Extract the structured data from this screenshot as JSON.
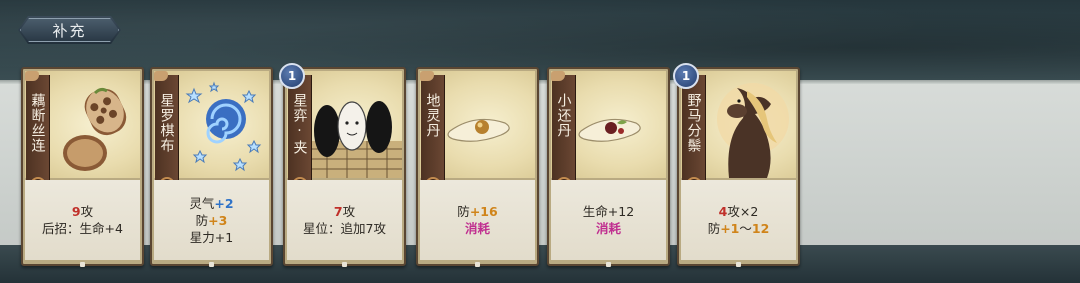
{
  "section": {
    "title": "补充"
  },
  "cards": [
    {
      "name": "藕断丝连",
      "icon": "lotus-root-icon",
      "badge": null,
      "desc": [
        "",
        "后招：生命+4"
      ],
      "attack": "9",
      "attack_suffix": "攻"
    },
    {
      "name": "星罗棋布",
      "icon": "star-swirl-icon",
      "badge": null,
      "lines": [
        {
          "label": "灵气",
          "value": "+2"
        },
        {
          "label": "防",
          "value": "+3"
        },
        {
          "label": "星力+1",
          "value": ""
        }
      ]
    },
    {
      "name": "星弈·夹",
      "icon": "go-stones-icon",
      "badge": "1",
      "attack": "7",
      "attack_suffix": "攻",
      "extra": "星位：追加7攻"
    },
    {
      "name": "地灵丹",
      "icon": "pill-icon",
      "badge": null,
      "def_label": "防",
      "def_value": "+16",
      "consume": "消耗"
    },
    {
      "name": "小还丹",
      "icon": "red-pill-icon",
      "badge": null,
      "life": "生命+12",
      "consume": "消耗"
    },
    {
      "name": "野马分鬃",
      "icon": "horse-icon",
      "badge": "1",
      "attack": "4",
      "attack_suffix": "攻×2",
      "def_label": "防",
      "def_a": "+1",
      "def_sep": "～",
      "def_b": "12"
    }
  ],
  "colors": {
    "attack": "#c0302a",
    "qi": "#2f73c8",
    "defense": "#d0841a",
    "consume": "#c03090"
  }
}
